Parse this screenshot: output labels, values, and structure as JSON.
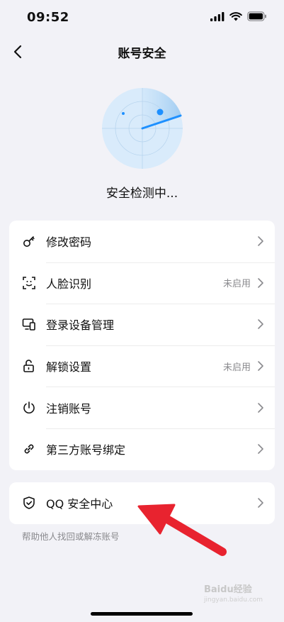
{
  "status_bar": {
    "time": "09:52"
  },
  "nav": {
    "title": "账号安全"
  },
  "scan": {
    "status_text": "安全检测中..."
  },
  "settings": [
    {
      "label": "修改密码",
      "icon": "key-icon",
      "status": ""
    },
    {
      "label": "人脸识别",
      "icon": "face-scan-icon",
      "status": "未启用"
    },
    {
      "label": "登录设备管理",
      "icon": "devices-icon",
      "status": ""
    },
    {
      "label": "解锁设置",
      "icon": "unlock-icon",
      "status": "未启用"
    },
    {
      "label": "注销账号",
      "icon": "power-icon",
      "status": ""
    },
    {
      "label": "第三方账号绑定",
      "icon": "link-icon",
      "status": ""
    }
  ],
  "qq_center": {
    "label": "QQ 安全中心",
    "icon": "shield-icon",
    "hint": "帮助他人找回或解冻账号"
  },
  "annotation": {
    "arrow_color": "#e8232f"
  },
  "watermark": {
    "text": "Baidu经验",
    "sub": "jingyan.baidu.com"
  },
  "colors": {
    "radar_fill": "#d9ebfb",
    "radar_accent": "#1e90ff",
    "background": "#f2f2f7"
  }
}
